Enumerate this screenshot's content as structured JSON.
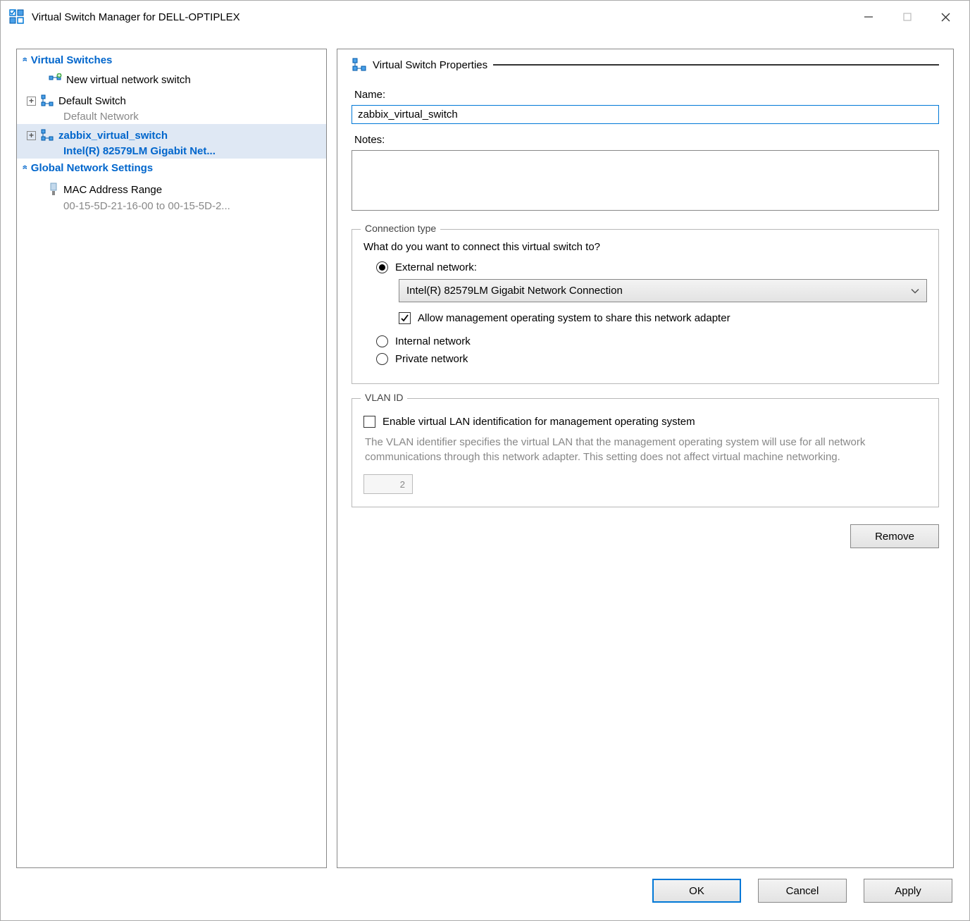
{
  "window": {
    "title": "Virtual Switch Manager for DELL-OPTIPLEX"
  },
  "leftPane": {
    "headers": {
      "virtualSwitches": "Virtual Switches",
      "globalNetwork": "Global Network Settings"
    },
    "newSwitch": "New virtual network switch",
    "defaultSwitch": {
      "name": "Default Switch",
      "sub": "Default Network"
    },
    "selectedSwitch": {
      "name": "zabbix_virtual_switch",
      "sub": "Intel(R) 82579LM Gigabit Net..."
    },
    "macRange": {
      "name": "MAC Address Range",
      "sub": "00-15-5D-21-16-00 to 00-15-5D-2..."
    }
  },
  "rightPane": {
    "sectionTitle": "Virtual Switch Properties",
    "nameLabel": "Name:",
    "nameValue": "zabbix_virtual_switch",
    "notesLabel": "Notes:",
    "notesValue": "",
    "connectionType": {
      "legend": "Connection type",
      "prompt": "What do you want to connect this virtual switch to?",
      "external": "External network:",
      "adapter": "Intel(R) 82579LM Gigabit Network Connection",
      "allowMgmt": "Allow management operating system to share this network adapter",
      "internal": "Internal network",
      "private": "Private network"
    },
    "vlan": {
      "legend": "VLAN ID",
      "enable": "Enable virtual LAN identification for management operating system",
      "help": "The VLAN identifier specifies the virtual LAN that the management operating system will use for all network communications through this network adapter. This setting does not affect virtual machine networking.",
      "value": "2"
    },
    "removeBtn": "Remove"
  },
  "footer": {
    "ok": "OK",
    "cancel": "Cancel",
    "apply": "Apply"
  }
}
